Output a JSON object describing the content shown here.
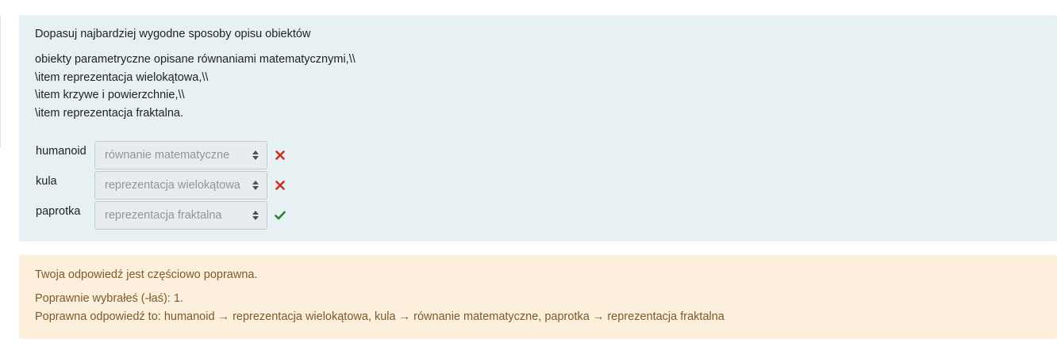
{
  "question": {
    "title": "Dopasuj najbardziej wygodne sposoby opisu obiektów",
    "text_lines": [
      "obiekty parametryczne opisane równaniami matematycznymi,\\\\",
      "\\item reprezentacja wielokątowa,\\\\",
      "\\item krzywe i powierzchnie,\\\\",
      "\\item reprezentacja fraktalna."
    ],
    "answers": [
      {
        "label": "humanoid",
        "selected": "równanie matematyczne",
        "result": "incorrect",
        "icon": "cross-icon"
      },
      {
        "label": "kula",
        "selected": "reprezentacja wielokątowa",
        "result": "incorrect",
        "icon": "cross-icon"
      },
      {
        "label": "paprotka",
        "selected": "reprezentacja fraktalna",
        "result": "correct",
        "icon": "check-icon"
      }
    ]
  },
  "feedback": {
    "status": "Twoja odpowiedź jest częściowo poprawna.",
    "correct_count": "Poprawnie wybrałeś (-łaś): 1.",
    "correct_answer": "Poprawna odpowiedź to: humanoid → reprezentacja wielokątowa, kula → równanie matematyczne, paprotka → reprezentacja fraktalna"
  },
  "colors": {
    "question_bg": "#e7f1f3",
    "feedback_bg": "#fcefdc",
    "incorrect": "#ca3120",
    "correct": "#357a32"
  }
}
